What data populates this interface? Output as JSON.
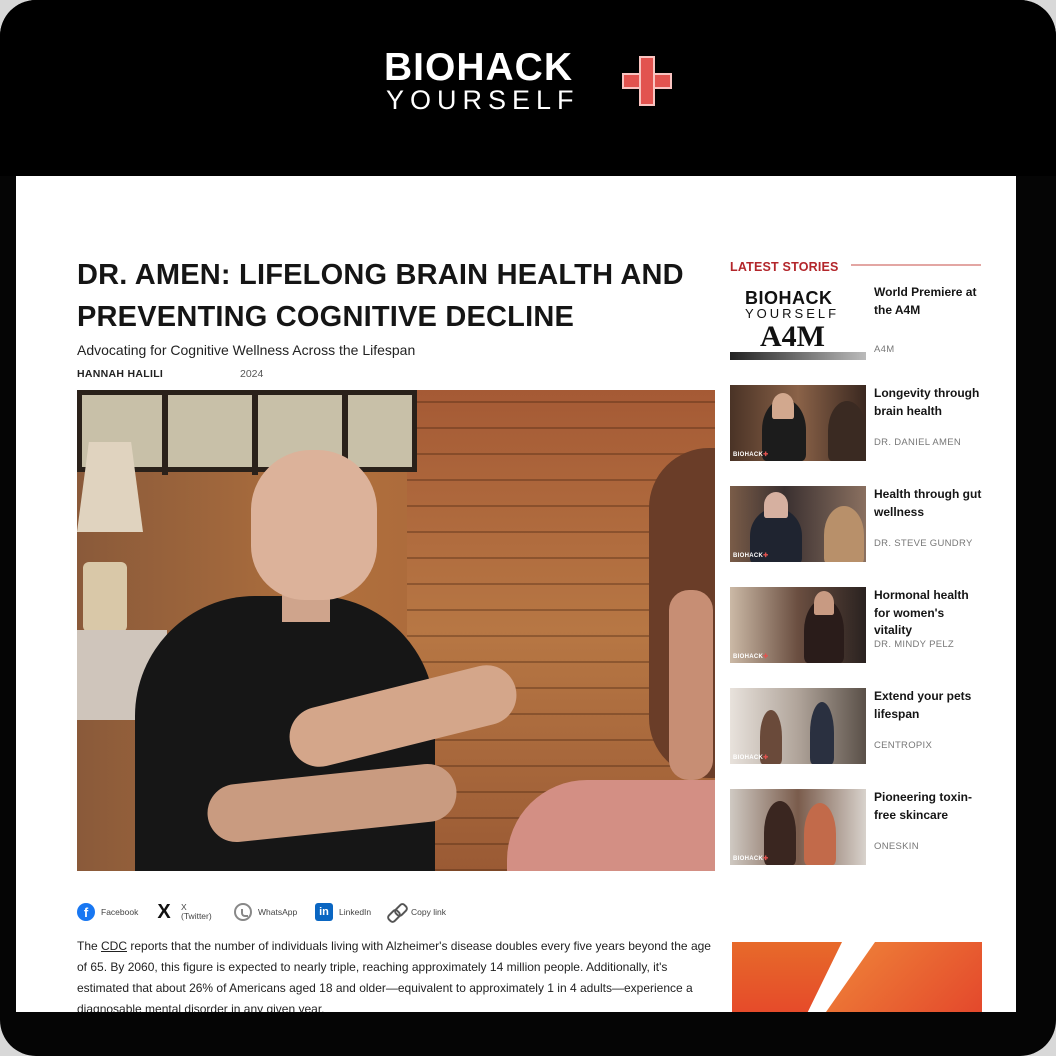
{
  "brand": {
    "logo_line1": "BIOHACK",
    "logo_line2": "YOURSELF",
    "accent_color": "#e2534f"
  },
  "article": {
    "title": "DR. AMEN: LIFELONG BRAIN HEALTH AND PREVENTING COGNITIVE DECLINE",
    "subtitle": "Advocating for Cognitive Wellness Across the Lifespan",
    "author": "HANNAH HALILI",
    "year": "2024",
    "body_link": "CDC",
    "body_text": " reports that the number of individuals living with Alzheimer's disease doubles every five years beyond the age of 65. By 2060, this figure is expected to nearly triple, reaching approximately 14 million people. Additionally, it's estimated that about 26% of Americans aged 18 and older—equivalent to approximately 1 in 4 adults—experience a diagnosable mental disorder in any given year.",
    "body_prefix": "The "
  },
  "share": {
    "facebook": "Facebook",
    "x_line1": "X",
    "x_line2": "(Twitter)",
    "whatsapp": "WhatsApp",
    "linkedin": "LinkedIn",
    "copy": "Copy link"
  },
  "sidebar": {
    "heading": "LATEST STORIES",
    "thumb_badge": "BIOHACK",
    "stories": [
      {
        "title": "World Premiere at the A4M",
        "author": "A4M",
        "thumb_text_1": "BIOHACK",
        "thumb_text_2": "YOURSELF",
        "thumb_text_3": "A4M"
      },
      {
        "title": "Longevity through brain health",
        "author": "DR. DANIEL AMEN"
      },
      {
        "title": "Health through gut wellness",
        "author": "DR. STEVE GUNDRY"
      },
      {
        "title": "Hormonal health for women's vitality",
        "author": "DR. MINDY PELZ"
      },
      {
        "title": "Extend your pets lifespan",
        "author": "CENTROPIX"
      },
      {
        "title": "Pioneering toxin-free skincare",
        "author": "ONESKIN"
      }
    ]
  }
}
